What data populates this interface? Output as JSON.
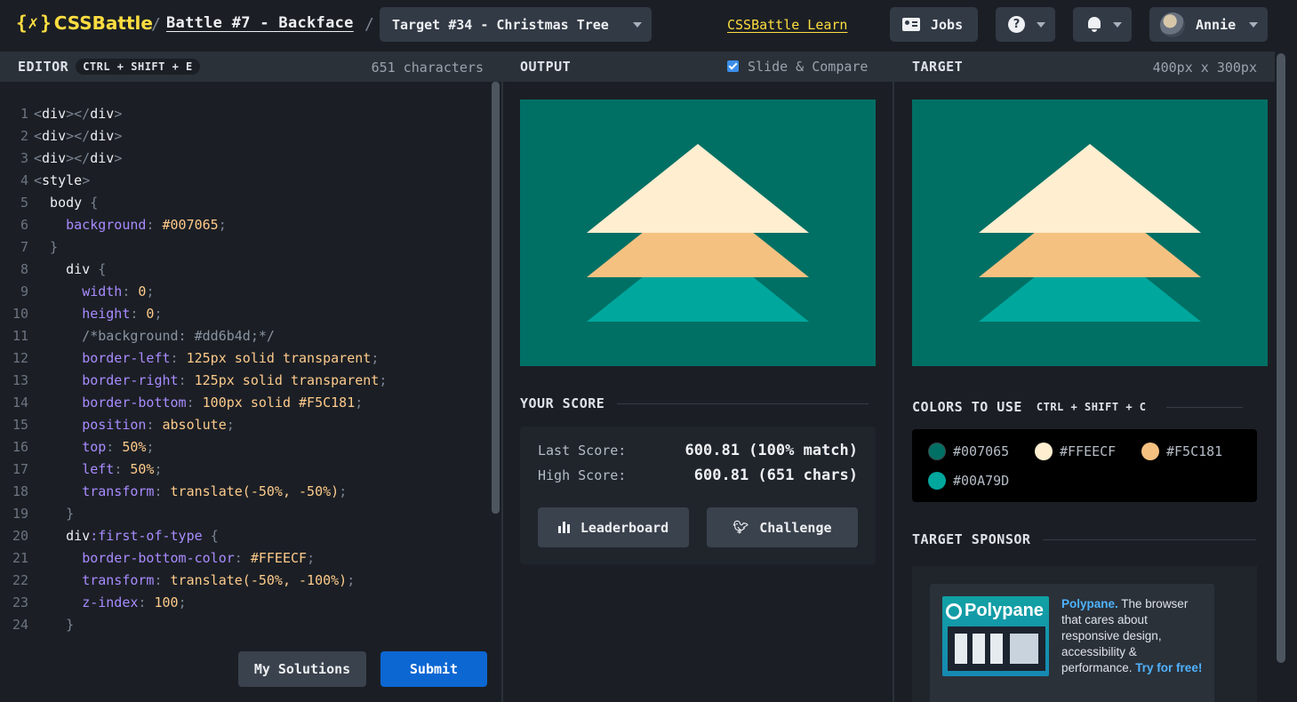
{
  "header": {
    "logo_open": "{",
    "logo_x": "✗",
    "logo_close": "}",
    "logo_name": "CSSBattle",
    "separator": "/",
    "battle_link": "Battle #7 - Backface",
    "target_select": "Target #34 - Christmas Tree",
    "learn_link": "CSSBattle Learn",
    "jobs_label": "Jobs",
    "help_icon": "?",
    "user_name": "Annie"
  },
  "editor": {
    "title": "EDITOR",
    "shortcut": "CTRL + SHIFT + E",
    "char_count": "651 characters",
    "lines": [
      "<div></div>",
      "<div></div>",
      "<div></div>",
      "<style>",
      "  body {",
      "    background: #007065;",
      "  }",
      "    div {",
      "      width: 0;",
      "      height: 0;",
      "      /*background: #dd6b4d;*/",
      "      border-left: 125px solid transparent;",
      "      border-right: 125px solid transparent;",
      "      border-bottom: 100px solid #F5C181;",
      "      position: absolute;",
      "      top: 50%;",
      "      left: 50%;",
      "      transform: translate(-50%, -50%);",
      "    }",
      "    div:first-of-type {",
      "      border-bottom-color: #FFEECF;",
      "      transform: translate(-50%, -100%);",
      "      z-index: 100;",
      "    }"
    ],
    "my_solutions_label": "My Solutions",
    "submit_label": "Submit"
  },
  "output": {
    "title": "OUTPUT",
    "slide_compare_label": "Slide & Compare",
    "slide_compare_checked": true
  },
  "target": {
    "title": "TARGET",
    "dimensions": "400px x 300px"
  },
  "score": {
    "title": "YOUR SCORE",
    "last_label": "Last Score:",
    "last_value": "600.81 (100% match)",
    "high_label": "High Score:",
    "high_value": "600.81 (651 chars)",
    "leaderboard_label": "Leaderboard",
    "challenge_label": "Challenge"
  },
  "colors": {
    "title": "COLORS TO USE",
    "shortcut": "CTRL + SHIFT + C",
    "items": [
      {
        "label": "#007065",
        "color": "#007065"
      },
      {
        "label": "#FFEECF",
        "color": "#FFEECF"
      },
      {
        "label": "#F5C181",
        "color": "#F5C181"
      },
      {
        "label": "#00A79D",
        "color": "#00A79D"
      }
    ]
  },
  "sponsor": {
    "title": "TARGET SPONSOR",
    "logo_text": "Polypane",
    "brand": "Polypane.",
    "description": " The browser that cares about responsive design, accessibility & performance. ",
    "cta": "Try for free!"
  },
  "theme": {
    "accent_yellow": "#ffdd40",
    "submit_blue": "#0c67d3",
    "bg": "#1b1f25"
  }
}
